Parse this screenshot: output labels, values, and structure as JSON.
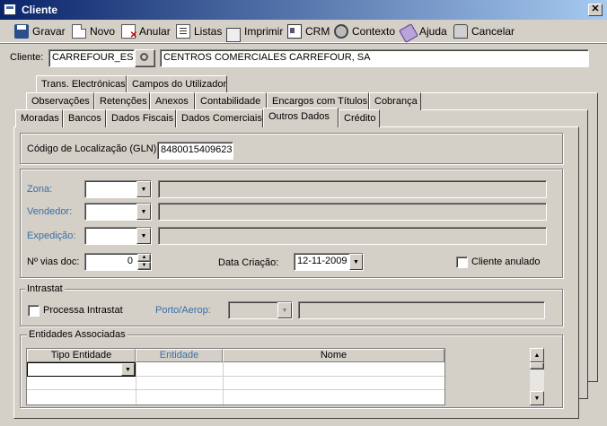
{
  "window": {
    "title": "Cliente",
    "close": "✕"
  },
  "toolbar": {
    "gravar": "Gravar",
    "novo": "Novo",
    "anular": "Anular",
    "listas": "Listas",
    "imprimir": "Imprimir",
    "crm": "CRM",
    "contexto": "Contexto",
    "ajuda": "Ajuda",
    "cancelar": "Cancelar"
  },
  "client": {
    "label": "Cliente:",
    "code": "CARREFOUR_ES",
    "name": "CENTROS COMERCIALES CARREFOUR, SA"
  },
  "tabs": {
    "row1": [
      "Trans. Electrónicas",
      "Campos do Utilizador"
    ],
    "row2": [
      "Observações",
      "Retenções",
      "Anexos",
      "Contabilidade",
      "Encargos com Títulos",
      "Cobrança"
    ],
    "row3": [
      "Moradas",
      "Bancos",
      "Dados Fiscais",
      "Dados Comerciais",
      "Outros Dados",
      "Crédito"
    ],
    "active": "Outros Dados"
  },
  "gln": {
    "label": "Código de Localização (GLN):",
    "value": "8480015409623"
  },
  "fields": {
    "zona": "Zona:",
    "vendedor": "Vendedor:",
    "expedicao": "Expedição:",
    "vias_label": "Nº vias doc:",
    "vias_value": "0",
    "data_label": "Data Criação:",
    "data_value": "12-11-2009",
    "anulado": "Cliente anulado"
  },
  "intrastat": {
    "title": "Intrastat",
    "processa": "Processa Intrastat",
    "porto": "Porto/Aerop:"
  },
  "entidades": {
    "title": "Entidades Associadas",
    "columns": [
      "Tipo Entidade",
      "Entidade",
      "Nome"
    ]
  }
}
